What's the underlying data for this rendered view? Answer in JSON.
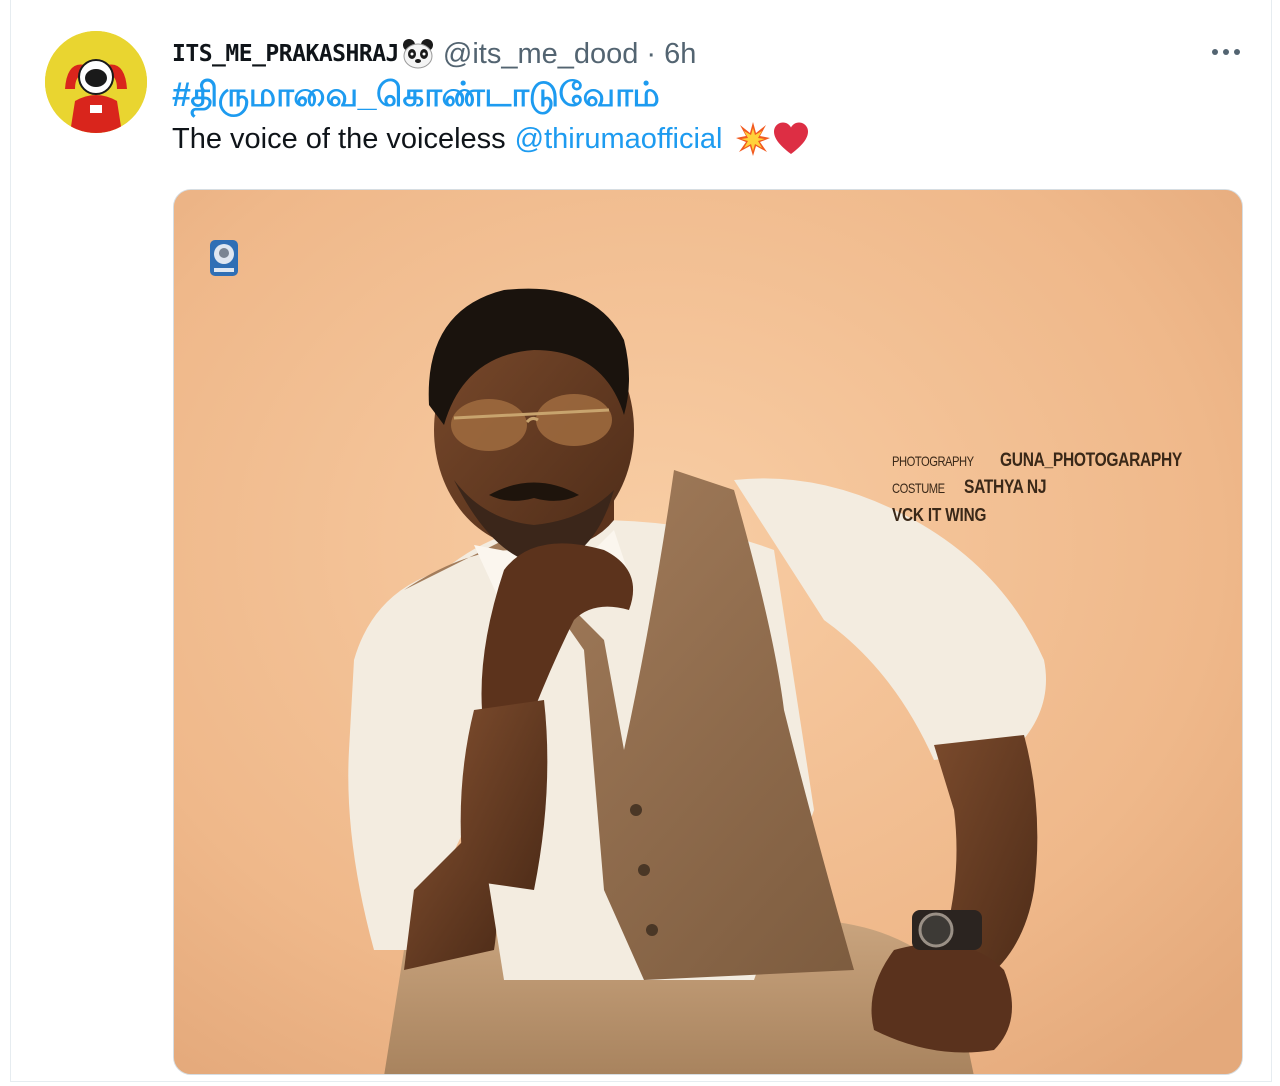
{
  "tweet": {
    "display_name": "ITS_ME_PRAKASHRAJ",
    "handle": "@its_me_dood",
    "separator": "·",
    "time": "6h",
    "hashtag": "#திருமாவை_கொண்டாடுவோம்",
    "text": "The voice of the voiceless",
    "mention": "@thirumaofficial",
    "emoji_1": "collision-emoji",
    "emoji_2": "red-heart-emoji",
    "avatar_icon": "astronaut-avatar",
    "name_emoji": "panda-face-emoji",
    "more_icon": "more-options-icon"
  },
  "media": {
    "credits": {
      "photography_label": "PHOTOGRAPHY",
      "photography_value": "GUNA_PHOTOGARAPHY",
      "costume_label": "COSTUME",
      "costume_value": "SATHYA NJ",
      "wing": "VCK IT WING"
    }
  },
  "colors": {
    "accent": "#1d9bf0",
    "text_primary": "#0f1419",
    "text_secondary": "#536471",
    "photo_background": "#efb98b"
  }
}
